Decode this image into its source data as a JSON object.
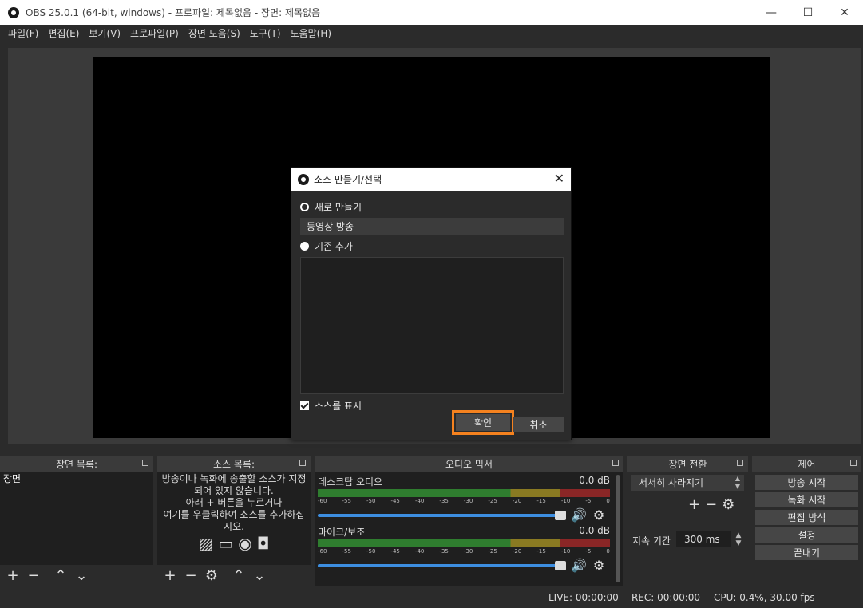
{
  "window": {
    "title": "OBS 25.0.1 (64-bit, windows) - 프로파일: 제목없음 - 장면: 제목없음",
    "minimize": "—",
    "maximize": "☐",
    "close": "✕"
  },
  "menu": [
    "파일(F)",
    "편집(E)",
    "보기(V)",
    "프로파일(P)",
    "장면 모음(S)",
    "도구(T)",
    "도움말(H)"
  ],
  "dialog": {
    "title": "소스 만들기/선택",
    "close": "✕",
    "create_new_label": "새로 만들기",
    "name_value": "동영상 방송",
    "add_existing_label": "기존 추가",
    "show_source_label": "소스를 표시",
    "ok_label": "확인",
    "cancel_label": "취소"
  },
  "scenes": {
    "header": "장면 목록:",
    "items": [
      "장면"
    ]
  },
  "sources": {
    "header": "소스 목록:",
    "empty_text": "방송이나 녹화에 송출할 소스가 지정되어 있지 않습니다.\n아래 + 버튼을 누르거나\n여기를 우클릭하여 소스를 추가하십시오."
  },
  "mixer": {
    "header": "오디오 믹서",
    "scale": [
      "-60",
      "-55",
      "-50",
      "-45",
      "-40",
      "-35",
      "-30",
      "-25",
      "-20",
      "-15",
      "-10",
      "-5",
      "0"
    ],
    "tracks": [
      {
        "name": "데스크탑 오디오",
        "level": "0.0 dB",
        "volume_fraction": 1.0
      },
      {
        "name": "마이크/보조",
        "level": "0.0 dB",
        "volume_fraction": 1.0
      }
    ]
  },
  "transitions": {
    "header": "장면 전환",
    "selected": "서서히 사라지기",
    "duration_label": "지속 기간",
    "duration_value": "300 ms"
  },
  "controls": {
    "header": "제어",
    "buttons": [
      "방송 시작",
      "녹화 시작",
      "편집 방식",
      "설정",
      "끝내기"
    ]
  },
  "status": {
    "live": "LIVE: 00:00:00",
    "rec": "REC: 00:00:00",
    "cpu": "CPU: 0.4%, 30.00 fps"
  },
  "colors": {
    "accent_highlight": "#f5821f",
    "volume_blue": "#3d8ee0"
  }
}
